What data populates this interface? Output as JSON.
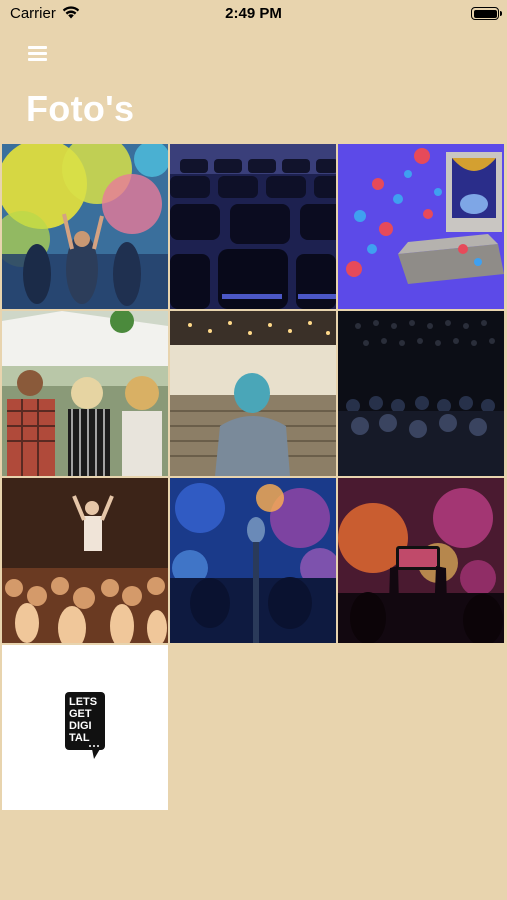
{
  "status_bar": {
    "carrier": "Carrier",
    "time": "2:49 PM"
  },
  "nav": {
    "menu_icon": "hamburger-menu-icon"
  },
  "page": {
    "title": "Foto's"
  },
  "photos": [
    {
      "subject": "color-festival-crowd"
    },
    {
      "subject": "empty-conference-chairs"
    },
    {
      "subject": "social-media-stage-illustration"
    },
    {
      "subject": "festival-audience-tent"
    },
    {
      "subject": "woman-in-auditorium"
    },
    {
      "subject": "dark-theater-audience"
    },
    {
      "subject": "concert-crowd-hands"
    },
    {
      "subject": "microphone-blue-lights"
    },
    {
      "subject": "phone-filming-concert"
    },
    {
      "subject": "lets-get-digital-logo",
      "logo_text": [
        "LETS",
        "GET",
        "DIGI",
        "TAL"
      ]
    }
  ],
  "colors": {
    "background": "#e8d4ae",
    "title": "#ffffff"
  }
}
